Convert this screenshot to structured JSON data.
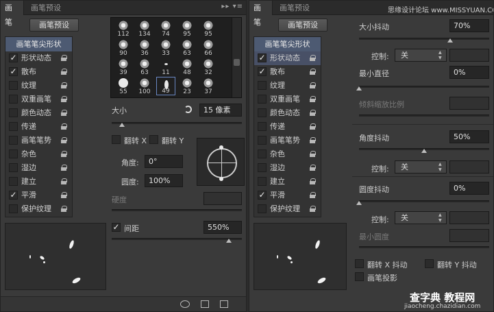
{
  "left": {
    "tabs": [
      "画笔",
      "画笔预设"
    ],
    "menu_glyph": "▸▸ ▾≡",
    "preset_button": "画笔预设",
    "list_items": [
      {
        "label": "画笔笔尖形状",
        "header": true
      },
      {
        "label": "形状动态",
        "checked": true,
        "lock": true
      },
      {
        "label": "散布",
        "checked": true,
        "lock": true
      },
      {
        "label": "纹理",
        "checked": false,
        "lock": true
      },
      {
        "label": "双重画笔",
        "checked": false,
        "lock": true
      },
      {
        "label": "颜色动态",
        "checked": false,
        "lock": true
      },
      {
        "label": "传递",
        "checked": false,
        "lock": true
      },
      {
        "label": "画笔笔势",
        "checked": false,
        "lock": true
      },
      {
        "label": "杂色",
        "checked": false,
        "lock": true
      },
      {
        "label": "湿边",
        "checked": false,
        "lock": true
      },
      {
        "label": "建立",
        "checked": false,
        "lock": true
      },
      {
        "label": "平滑",
        "checked": true,
        "lock": true
      },
      {
        "label": "保护纹理",
        "checked": false,
        "lock": true
      }
    ],
    "brush_tips": [
      "112",
      "134",
      "74",
      "95",
      "95",
      "90",
      "36",
      "33",
      "63",
      "66",
      "39",
      "63",
      "11",
      "48",
      "32",
      "55",
      "100",
      "49",
      "23",
      "37"
    ],
    "selected_tip": "49",
    "size_label": "大小",
    "size_value": "15 像素",
    "flip_x": "翻转 X",
    "flip_y": "翻转 Y",
    "angle_label": "角度:",
    "angle_value": "0°",
    "roundness_label": "圆度:",
    "roundness_value": "100%",
    "hardness_label": "硬度",
    "spacing_label": "间距",
    "spacing_checked": true,
    "spacing_value": "550%",
    "size_fraction": 0.02,
    "spacing_fraction": 0.9
  },
  "right": {
    "tabs": [
      "画笔",
      "画笔预设"
    ],
    "watermark_text": "思缘设计论坛 www.MISSYUAN.COM",
    "preset_button": "画笔预设",
    "list_items": [
      {
        "label": "画笔笔尖形状",
        "header": true
      },
      {
        "label": "形状动态",
        "checked": true,
        "lock": true,
        "selected": true
      },
      {
        "label": "散布",
        "checked": true,
        "lock": true
      },
      {
        "label": "纹理",
        "checked": false,
        "lock": true
      },
      {
        "label": "双重画笔",
        "checked": false,
        "lock": true
      },
      {
        "label": "颜色动态",
        "checked": false,
        "lock": true
      },
      {
        "label": "传递",
        "checked": false,
        "lock": true
      },
      {
        "label": "画笔笔势",
        "checked": false,
        "lock": true
      },
      {
        "label": "杂色",
        "checked": false,
        "lock": true
      },
      {
        "label": "湿边",
        "checked": false,
        "lock": true
      },
      {
        "label": "建立",
        "checked": false,
        "lock": true
      },
      {
        "label": "平滑",
        "checked": true,
        "lock": true
      },
      {
        "label": "保护纹理",
        "checked": false,
        "lock": true
      }
    ],
    "size_jitter_label": "大小抖动",
    "size_jitter_value": "70%",
    "size_jitter_fraction": 0.7,
    "control_label": "控制:",
    "control_value": "关",
    "min_diameter_label": "最小直径",
    "min_diameter_value": "0%",
    "tilt_scale_label": "倾斜缩放比例",
    "angle_jitter_label": "角度抖动",
    "angle_jitter_value": "50%",
    "angle_jitter_fraction": 0.5,
    "roundness_jitter_label": "圆度抖动",
    "roundness_jitter_value": "0%",
    "min_roundness_label": "最小圆度",
    "flip_x_jitter": "翻转 X 抖动",
    "flip_y_jitter": "翻转 Y 抖动",
    "brush_projection": "画笔投影",
    "bottom_watermark": "查字典 教程网",
    "bottom_url": "jiaocheng.chazidian.com"
  }
}
